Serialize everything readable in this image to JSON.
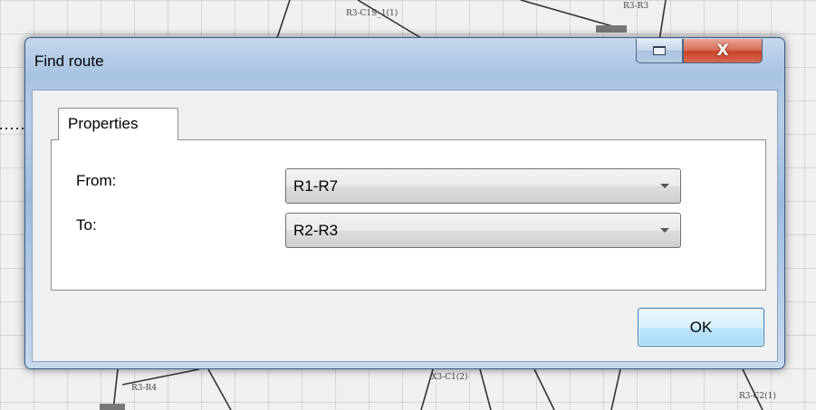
{
  "background": {
    "edge_labels": [
      "R3-R3",
      "R3-C1S_1(1)",
      "R3-R4",
      "X3-C1(2)",
      "R3-C2(1)"
    ]
  },
  "dialog": {
    "title": "Find route",
    "restore_icon": "restore-icon",
    "close_glyph": "X",
    "tab_label": "Properties",
    "from_label": "From:",
    "from_value": "R1-R7",
    "to_label": "To:",
    "to_value": "R2-R3",
    "ok_label": "OK"
  },
  "colors": {
    "title_bar": "#a8c3e2",
    "close_button": "#c7432a",
    "ok_button": "#bee6fd"
  }
}
